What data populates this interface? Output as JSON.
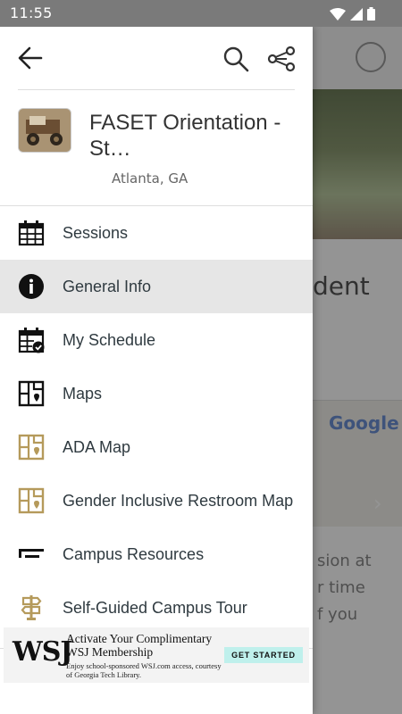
{
  "status_bar": {
    "time": "11:55"
  },
  "drawer": {
    "event": {
      "name": "FASET Orientation - St…",
      "location": "Atlanta, GA"
    },
    "menu": [
      {
        "label": "Sessions",
        "icon": "calendar-grid-icon",
        "active": false
      },
      {
        "label": "General Info",
        "icon": "info-icon",
        "active": true
      },
      {
        "label": "My Schedule",
        "icon": "calendar-check-icon",
        "active": false
      },
      {
        "label": "Maps",
        "icon": "map-icon",
        "active": false
      },
      {
        "label": "ADA Map",
        "icon": "map-pin-gold-icon",
        "active": false
      },
      {
        "label": "Gender Inclusive Restroom Map",
        "icon": "map-pin-gold-icon",
        "active": false
      },
      {
        "label": "Campus Resources",
        "icon": "georgia-tech-logo-icon",
        "active": false
      },
      {
        "label": "Self-Guided Campus Tour",
        "icon": "signpost-icon",
        "active": false
      }
    ]
  },
  "background": {
    "title_fragment": "dent",
    "map_brand": "Google",
    "text_lines": [
      "sion at",
      "r time",
      "f you"
    ]
  },
  "ad": {
    "logo": "WSJ",
    "headline": "Activate Your Complimentary WSJ Membership",
    "subtext": "Enjoy school-sponsored WSJ.com access, courtesy of Georgia Tech Library.",
    "cta": "GET STARTED"
  },
  "colors": {
    "gold": "#b59a5b",
    "active_bg": "#e6e6e6",
    "text": "#2f3a40",
    "cta_bg": "#bff0ec"
  }
}
